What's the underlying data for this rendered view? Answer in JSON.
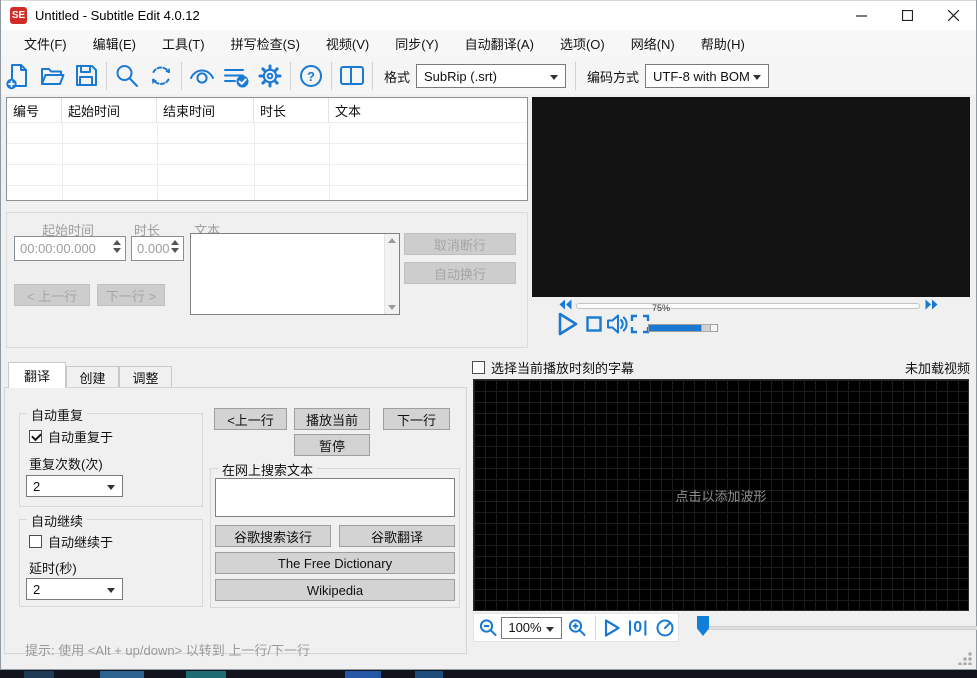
{
  "colors": {
    "accent_blue": "#1979d3",
    "logo_red": "#d22c26"
  },
  "titlebar": {
    "logo_text": "SE",
    "title": "Untitled - Subtitle Edit 4.0.12"
  },
  "menu": {
    "items": [
      "文件(F)",
      "编辑(E)",
      "工具(T)",
      "拼写检查(S)",
      "视频(V)",
      "同步(Y)",
      "自动翻译(A)",
      "选项(O)",
      "网络(N)",
      "帮助(H)"
    ]
  },
  "toolbar": {
    "format_label": "格式",
    "format_value": "SubRip (.srt)",
    "encoding_label": "编码方式",
    "encoding_value": "UTF-8 with BOM"
  },
  "subtitle_list": {
    "columns": [
      "编号",
      "起始时间",
      "结束时间",
      "时长",
      "文本"
    ]
  },
  "edit_panel": {
    "start_time_label": "起始时间",
    "start_time_value": "00:00:00.000",
    "duration_label": "时长",
    "duration_value": "0.000",
    "text_label": "文本",
    "unbreak_button": "取消断行",
    "autobreak_button": "自动换行",
    "prev_button": "< 上一行",
    "next_button": "下一行 >"
  },
  "video": {
    "volume_percent": "75%"
  },
  "bottom_tabs": {
    "tabs": [
      "翻译",
      "创建",
      "调整"
    ]
  },
  "translate": {
    "auto_repeat_group": "自动重复",
    "auto_repeat_checkbox": "自动重复于",
    "repeat_count_label": "重复次数(次)",
    "repeat_count_value": "2",
    "auto_continue_group": "自动继续",
    "auto_continue_checkbox": "自动继续于",
    "delay_label": "延时(秒)",
    "delay_value": "2",
    "prev_line_button": "<上一行",
    "play_current_button": "播放当前",
    "next_line_button": "下一行",
    "pause_button": "暂停",
    "web_search_group": "在网上搜索文本",
    "google_search_button": "谷歌搜索该行",
    "google_translate_button": "谷歌翻译",
    "free_dictionary_button": "The Free Dictionary",
    "wikipedia_button": "Wikipedia",
    "hint": "提示: 使用 <Alt + up/down> 以转到 上一行/下一行"
  },
  "waveform": {
    "select_checkbox_label": "选择当前播放时刻的字幕",
    "video_status": "未加载视频",
    "placeholder": "点击以添加波形",
    "zoom_value": "100%",
    "play_from_zero_glyph": "|0|"
  }
}
